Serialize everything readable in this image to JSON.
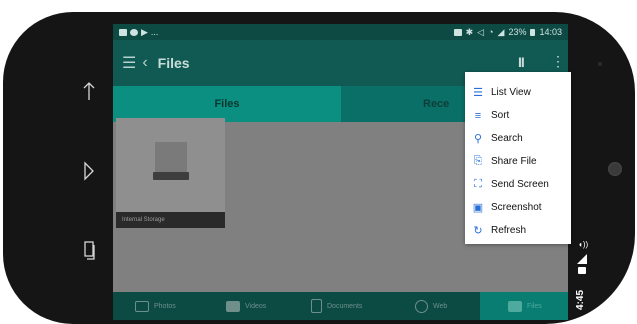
{
  "statusbar": {
    "left_icons": [
      "image-icon",
      "sync-icon",
      "play-icon"
    ],
    "left_more": "...",
    "battery": "23%",
    "time": "14:03"
  },
  "appbar": {
    "title": "Files",
    "menu_icon": "☰",
    "back_icon": "‹",
    "pause_icon": "II",
    "more_icon": "⋮"
  },
  "tabs": [
    {
      "label": "Files",
      "active": true
    },
    {
      "label": "Rece",
      "active": false
    }
  ],
  "storage": {
    "label": "Internal Storage"
  },
  "bottom_nav": [
    {
      "label": "Photos",
      "icon": "photo-icon"
    },
    {
      "label": "Videos",
      "icon": "video-icon"
    },
    {
      "label": "Documents",
      "icon": "document-icon"
    },
    {
      "label": "Web",
      "icon": "globe-icon"
    },
    {
      "label": "Files",
      "icon": "folder-icon",
      "active": true
    }
  ],
  "menu": {
    "items": [
      {
        "label": "List View",
        "icon": "☰",
        "icon_name": "list-icon"
      },
      {
        "label": "Sort",
        "icon": "≡",
        "icon_name": "sort-icon"
      },
      {
        "label": "Search",
        "icon": "⚲",
        "icon_name": "search-icon"
      },
      {
        "label": "Share File",
        "icon": "⎘",
        "icon_name": "share-icon"
      },
      {
        "label": "Send Screen",
        "icon": "⛶",
        "icon_name": "send-screen-icon"
      },
      {
        "label": "Screenshot",
        "icon": "▣",
        "icon_name": "screenshot-icon"
      },
      {
        "label": "Refresh",
        "icon": "↻",
        "icon_name": "refresh-icon"
      }
    ]
  },
  "emulator": {
    "side_time": "4:45",
    "nav_icons": [
      "up-arrow-icon",
      "right-arrow-icon",
      "recents-icon"
    ]
  },
  "colors": {
    "appbar": "#115a54",
    "tab_active": "#0b8f80",
    "menu_icon": "#2a6fd8"
  }
}
